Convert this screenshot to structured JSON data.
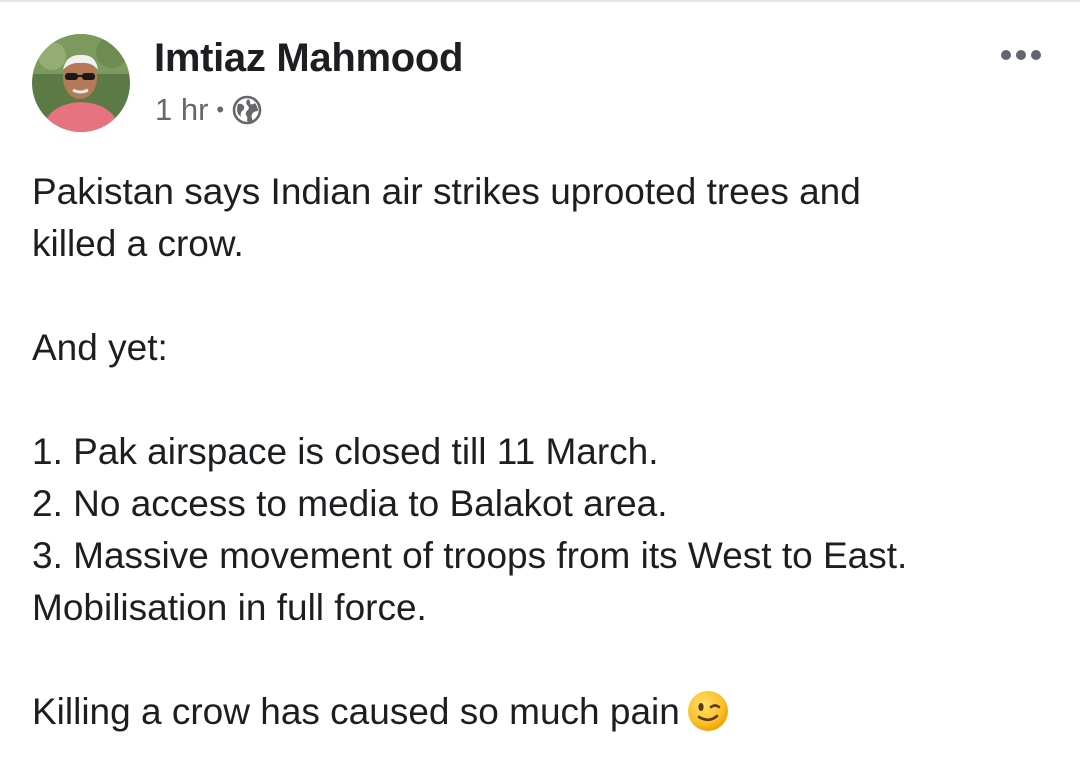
{
  "post": {
    "author": "Imtiaz Mahmood",
    "timestamp": "1 hr",
    "separator": "•",
    "privacy_icon": "globe-icon",
    "menu_icon": "more-options-icon",
    "body": {
      "line1": "Pakistan says Indian air strikes uprooted trees and",
      "line2": "killed a crow.",
      "line3": "And yet:",
      "line4": "1. Pak airspace is closed till 11 March.",
      "line5": "2. No access to media to Balakot area.",
      "line6": "3. Massive movement of troops from its West to East.",
      "line7": "Mobilisation in full force.",
      "line8": "Killing a crow has caused so much pain"
    },
    "emoji": "winking-face-emoji"
  },
  "colors": {
    "text": "#1c1e21",
    "meta": "#65676b",
    "menu_dots": "#606770"
  }
}
